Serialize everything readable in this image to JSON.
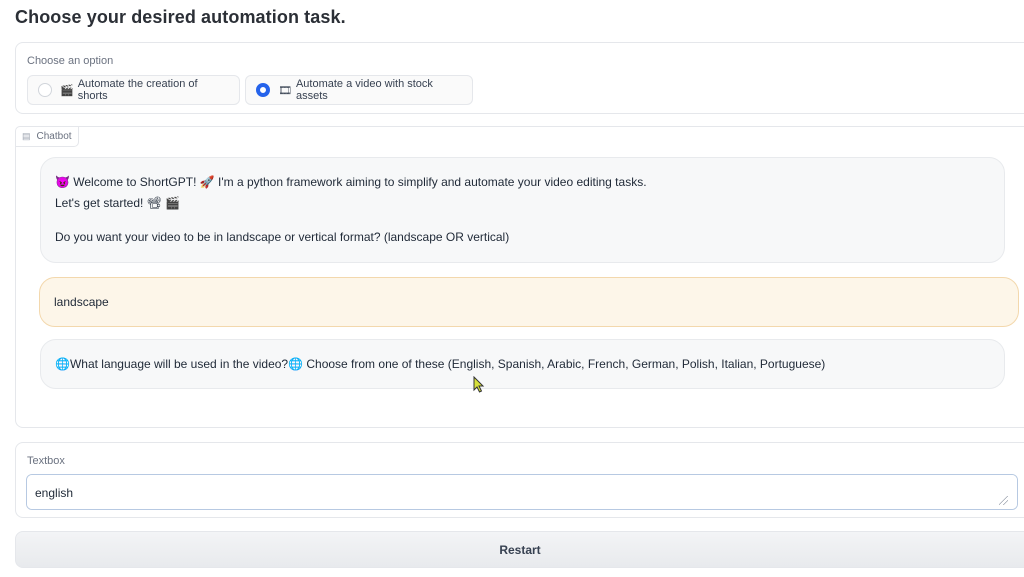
{
  "page": {
    "title": "Choose your desired automation task."
  },
  "options": {
    "label": "Choose an option",
    "items": [
      {
        "emoji": "🎬",
        "label": "Automate the creation of shorts",
        "selected": false
      },
      {
        "emoji": "🎞",
        "label": "Automate a video with stock assets",
        "selected": true
      }
    ],
    "accent_color": "#2563eb"
  },
  "chatbot": {
    "label": "Chatbot",
    "messages": [
      {
        "role": "bot",
        "lines": [
          "😈 Welcome to ShortGPT! 🚀 I'm a python framework aiming to simplify and automate your video editing tasks.",
          "Let's get started! 📽 🎬",
          "Do you want your video to be in landscape or vertical format? (landscape OR vertical)"
        ]
      },
      {
        "role": "user",
        "text": "landscape"
      },
      {
        "role": "bot",
        "text": "🌐What language will be used in the video?🌐 Choose from one of these (English, Spanish, Arabic, French, German, Polish, Italian, Portuguese)"
      }
    ]
  },
  "textbox": {
    "label": "Textbox",
    "value": "english"
  },
  "actions": {
    "restart_label": "Restart"
  }
}
